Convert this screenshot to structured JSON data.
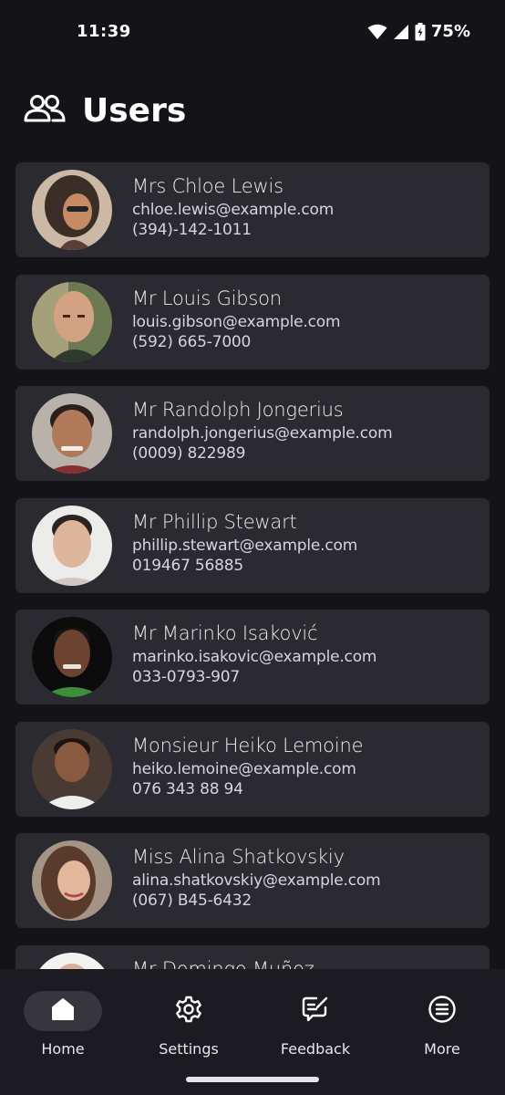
{
  "status_bar": {
    "time": "11:39",
    "battery": "75%"
  },
  "header": {
    "title": "Users",
    "icon": "users-icon"
  },
  "users": [
    {
      "name": "Mrs Chloe Lewis",
      "email": "chloe.lewis@example.com",
      "phone": "(394)-142-1011"
    },
    {
      "name": "Mr Louis Gibson",
      "email": "louis.gibson@example.com",
      "phone": "(592) 665-7000"
    },
    {
      "name": "Mr Randolph Jongerius",
      "email": "randolph.jongerius@example.com",
      "phone": "(0009) 822989"
    },
    {
      "name": "Mr Phillip Stewart",
      "email": "phillip.stewart@example.com",
      "phone": "019467 56885"
    },
    {
      "name": "Mr Marinko Isaković",
      "email": "marinko.isakovic@example.com",
      "phone": "033-0793-907"
    },
    {
      "name": "Monsieur Heiko Lemoine",
      "email": "heiko.lemoine@example.com",
      "phone": "076 343 88 94"
    },
    {
      "name": "Miss Alina Shatkovskiy",
      "email": "alina.shatkovskiy@example.com",
      "phone": "(067) B45-6432"
    },
    {
      "name": "Mr Domingo Muñoz",
      "email": "",
      "phone": ""
    }
  ],
  "bottom_nav": {
    "items": [
      {
        "label": "Home",
        "icon": "home-icon",
        "active": true
      },
      {
        "label": "Settings",
        "icon": "gear-icon",
        "active": false
      },
      {
        "label": "Feedback",
        "icon": "feedback-icon",
        "active": false
      },
      {
        "label": "More",
        "icon": "more-list-icon",
        "active": false
      }
    ]
  },
  "colors": {
    "background": "#141318",
    "card": "#2b2a31",
    "nav_background": "#1c1b21",
    "active_pill": "#37363e",
    "text": "#ececf0"
  }
}
